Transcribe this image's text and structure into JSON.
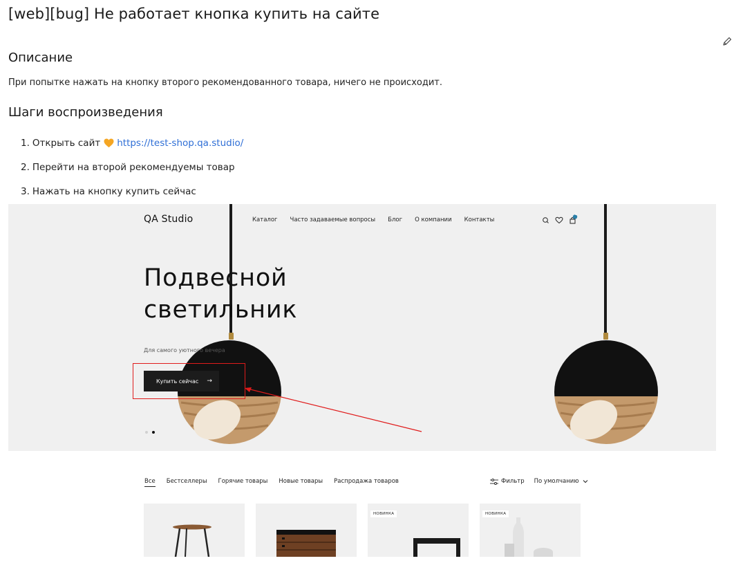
{
  "issue": {
    "title": "[web][bug] Не работает кнопка купить на сайте",
    "description_heading": "Описание",
    "description_text": "При попытке нажать на кнопку второго рекомендованного товара, ничего не происходит.",
    "steps_heading": "Шаги воспроизведения",
    "steps": [
      {
        "num": "1.",
        "text": "Открыть сайт",
        "link": "https://test-shop.qa.studio/"
      },
      {
        "num": "2.",
        "text": "Перейти на второй рекомендуемы товар"
      },
      {
        "num": "3.",
        "text": "Нажать на кнопку купить сейчас"
      }
    ],
    "icons": {
      "edit": "pencil-icon",
      "heart": "orange-heart-icon"
    },
    "colors": {
      "link": "#2f6fd6",
      "annotation": "#e01b1b",
      "heart": "#f5a623"
    }
  },
  "site": {
    "logo": "QA Studio",
    "nav": [
      "Каталог",
      "Часто задаваемые вопросы",
      "Блог",
      "О компании",
      "Контакты"
    ],
    "cart_count": "1",
    "hero": {
      "title_line1": "Подвесной",
      "title_line2": "светильник",
      "subtitle": "Для самого уютного вечера",
      "button_label": "Купить сейчас",
      "button_arrow": "→"
    },
    "filter_tabs": [
      "Все",
      "Бестселлеры",
      "Горячие товары",
      "Новые товары",
      "Распродажа товаров"
    ],
    "filter_label": "Фильтр",
    "sort_label": "По умолчанию",
    "badge_new": "НОВИНКА"
  }
}
